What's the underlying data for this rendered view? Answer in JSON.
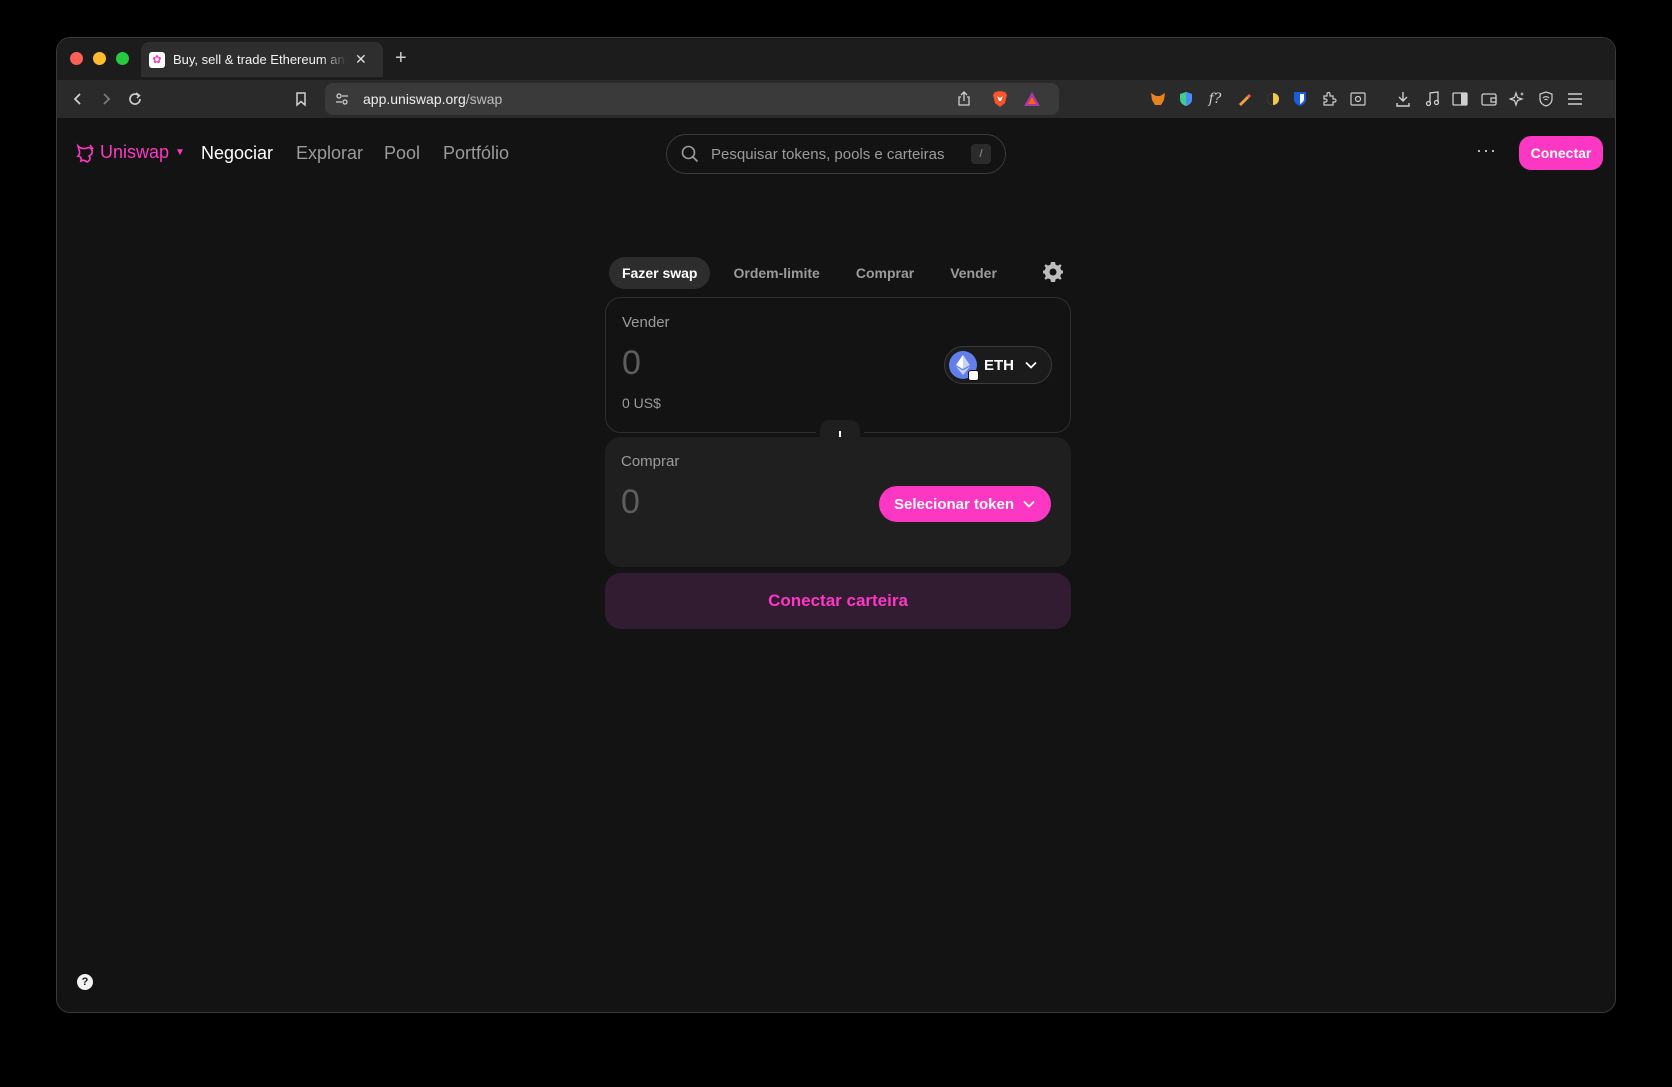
{
  "browser": {
    "tab_title": "Buy, sell & trade Ethereum and",
    "tab_close": "✕",
    "new_tab": "+",
    "url_host": "app.uniswap.org",
    "url_path": "/swap"
  },
  "header": {
    "brand": "Uniswap",
    "nav": [
      "Negociar",
      "Explorar",
      "Pool",
      "Portfólio"
    ],
    "active_nav": "Negociar",
    "search_placeholder": "Pesquisar tokens, pools e carteiras",
    "search_shortcut": "/",
    "more": "···",
    "connect_label": "Conectar"
  },
  "swap": {
    "tabs": [
      "Fazer swap",
      "Ordem-limite",
      "Comprar",
      "Vender"
    ],
    "active_tab": "Fazer swap",
    "sell": {
      "label": "Vender",
      "amount": "0",
      "fiat": "0 US$",
      "token": "ETH"
    },
    "buy": {
      "label": "Comprar",
      "amount": "0",
      "select_label": "Selecionar token"
    },
    "connect_wallet": "Conectar carteira"
  },
  "footer": {
    "help": "?"
  },
  "colors": {
    "accent": "#fc37c3",
    "background": "#131313",
    "surface": "#1f1f1f"
  }
}
